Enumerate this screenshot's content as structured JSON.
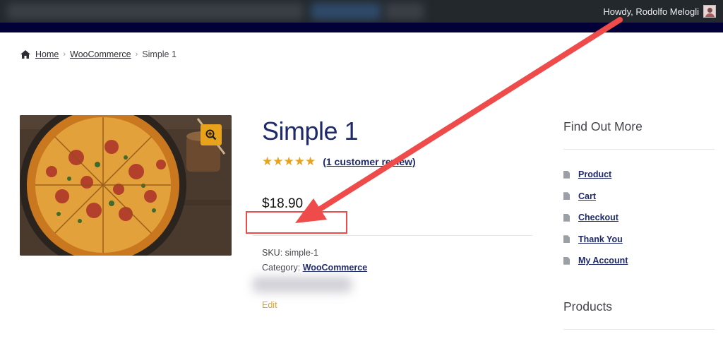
{
  "admin_bar": {
    "greeting": "Howdy, Rodolfo Melogli",
    "colors": {
      "bar": "#23282d",
      "nav_band": "#020036"
    }
  },
  "breadcrumb": {
    "icon": "home-icon",
    "items": [
      {
        "label": "Home",
        "link": true
      },
      {
        "label": "WooCommerce",
        "link": true
      },
      {
        "label": "Simple 1",
        "link": false
      }
    ]
  },
  "product": {
    "image_icon": "pizza-photo",
    "zoom_icon": "zoom-in-icon",
    "title": "Simple 1",
    "rating": 5,
    "stars": "★★★★★",
    "review_link": "(1 customer review)",
    "price": "$18.90",
    "sku_label": "SKU:",
    "sku_value": "simple-1",
    "category_label": "Category:",
    "category_value": "WooCommerce",
    "edit_link": "Edit"
  },
  "sidebar": {
    "find_out_more": {
      "title": "Find Out More",
      "items": [
        {
          "label": "Product",
          "icon": "page-icon"
        },
        {
          "label": "Cart",
          "icon": "page-icon"
        },
        {
          "label": "Checkout",
          "icon": "page-icon"
        },
        {
          "label": "Thank You",
          "icon": "page-icon"
        },
        {
          "label": "My Account",
          "icon": "page-icon"
        }
      ]
    },
    "products": {
      "title": "Products"
    }
  },
  "colors": {
    "accent": "#e8a21c",
    "link": "#1f2a6b",
    "annotation": "#ef4b4b"
  }
}
